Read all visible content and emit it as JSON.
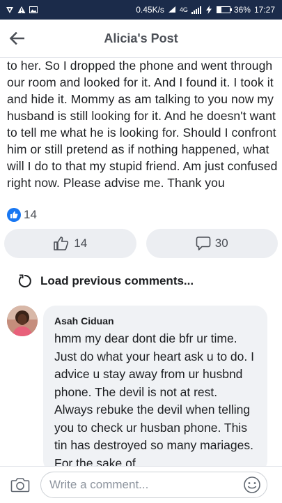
{
  "status_bar": {
    "network_speed": "0.45K/s",
    "network_type": "4G",
    "battery_percent": "36%",
    "battery_level": 0.36,
    "time": "17:27",
    "icons": [
      "notification-icon",
      "warning-icon",
      "image-icon",
      "wifi-icon",
      "signal-icon",
      "charging-icon"
    ]
  },
  "header": {
    "title": "Alicia's Post",
    "back_icon": "arrow-left-icon"
  },
  "post": {
    "text": "to her. So I dropped the phone and went through our room and looked for it. And I found it. I took it and hide it. Mommy as am talking to you now my husband is still looking for it. And he doesn't want to tell me what he is looking for. Should I confront him or still pretend as if nothing happened, what will I do to that my stupid friend. Am just confused right now. Please advise me. Thank you",
    "reaction_count": "14"
  },
  "actions": {
    "like_count": "14",
    "comment_count": "30"
  },
  "comments_section": {
    "load_previous_label": "Load previous comments...",
    "comments": [
      {
        "author": "Asah Ciduan",
        "text": "hmm my dear dont die bfr ur time. Just do what your heart ask u to do. I advice u stay away from ur husbnd phone. The devil is not at rest. Always rebuke the devil when telling you to check ur husban phone. This tin has destroyed so many mariages. For the sake of"
      }
    ]
  },
  "composer": {
    "placeholder": "Write a comment..."
  },
  "colors": {
    "status_bar_bg": "#1b2b4a",
    "accent": "#1877f2",
    "pill_bg": "#eceef2",
    "bubble_bg": "#f0f2f5"
  }
}
